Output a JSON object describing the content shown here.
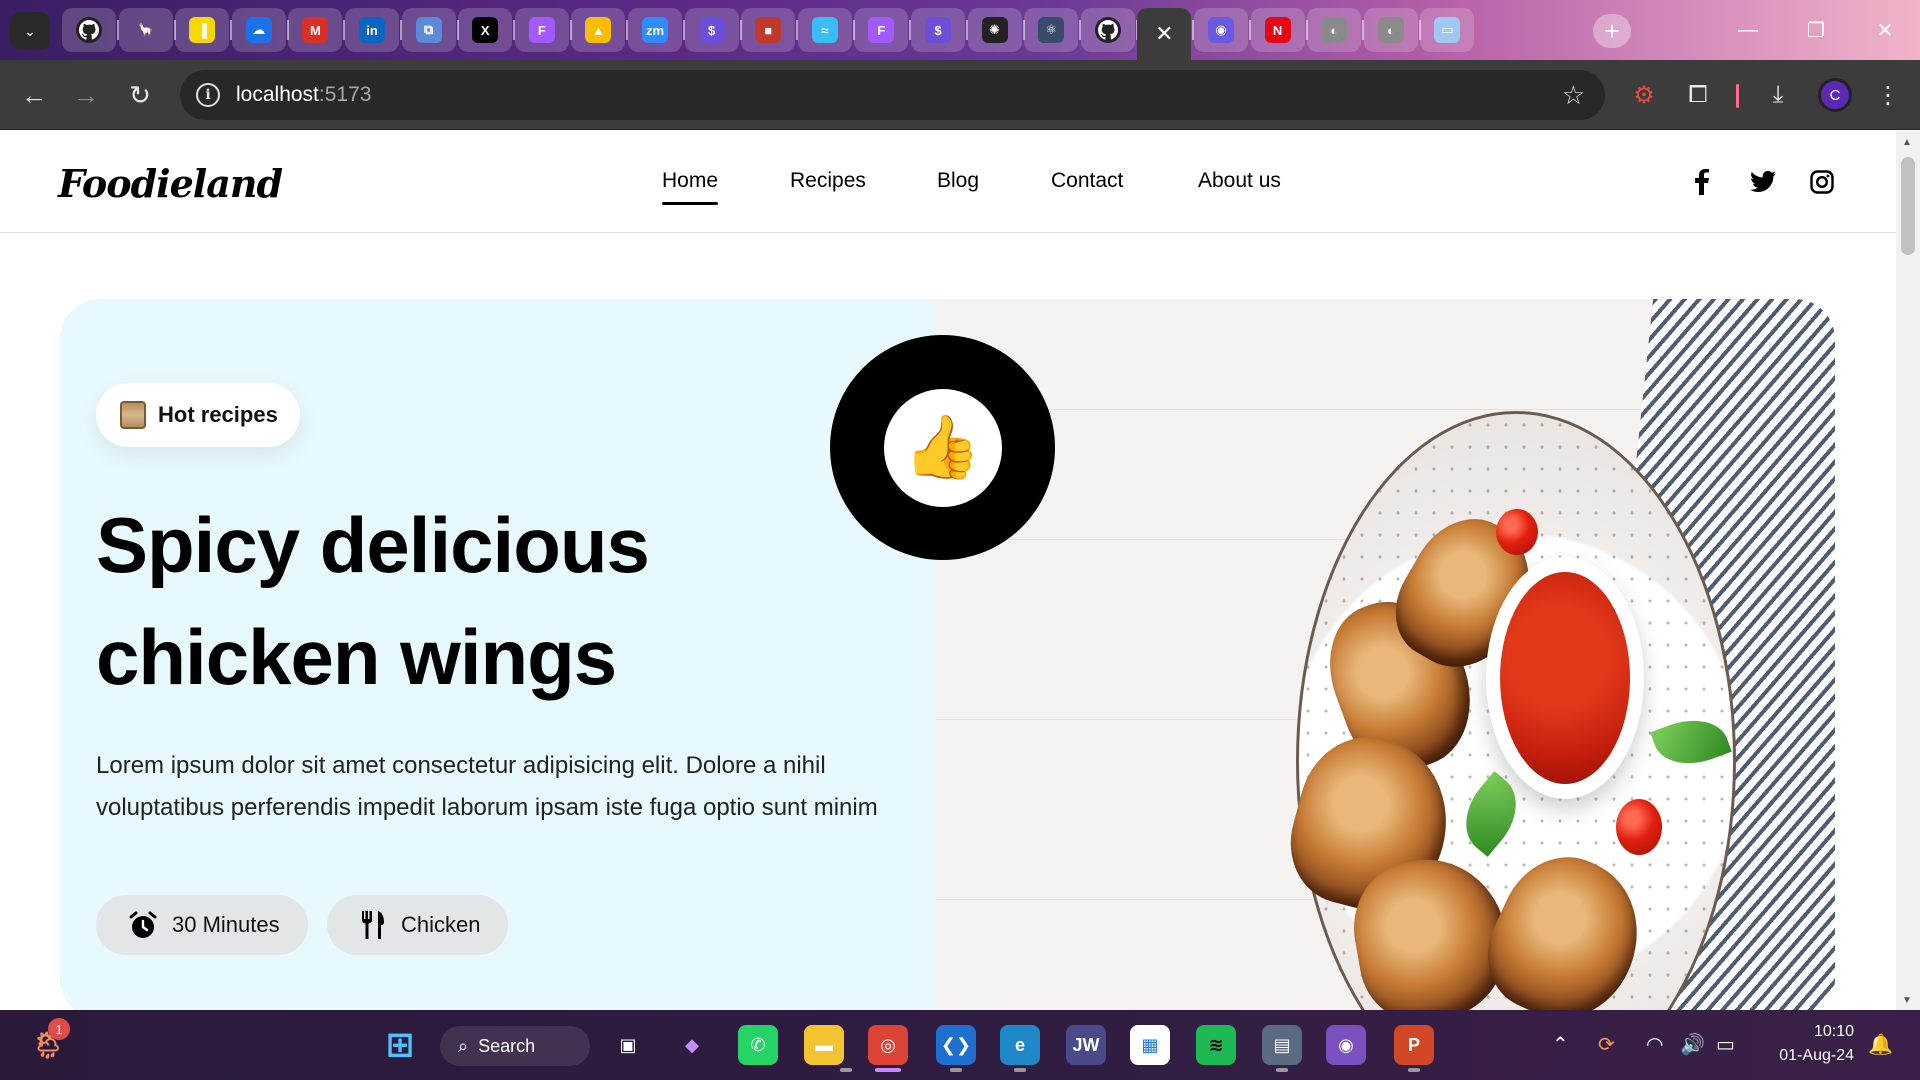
{
  "browser": {
    "url_host": "localhost",
    "url_port": ":5173",
    "profile_initial": "C",
    "tabs": [
      {
        "icon": "github-icon",
        "glyph": "",
        "bg": "#222222"
      },
      {
        "icon": "llama-icon",
        "glyph": "🦙",
        "bg": "transparent"
      },
      {
        "icon": "notes-icon",
        "glyph": "▐",
        "bg": "#f5d800"
      },
      {
        "icon": "cloud-icon",
        "glyph": "☁",
        "bg": "#1a73e8"
      },
      {
        "icon": "gmail-icon",
        "glyph": "M",
        "bg": "#d93025"
      },
      {
        "icon": "linkedin-icon",
        "glyph": "in",
        "bg": "#0a66c2"
      },
      {
        "icon": "crop-icon",
        "glyph": "⧉",
        "bg": "#5a8ad8"
      },
      {
        "icon": "x-icon",
        "glyph": "X",
        "bg": "#000000"
      },
      {
        "icon": "figma-icon",
        "glyph": "F",
        "bg": "#a259ff"
      },
      {
        "icon": "google-ads-icon",
        "glyph": "▲",
        "bg": "#fbbc04"
      },
      {
        "icon": "zoom-icon",
        "glyph": "zm",
        "bg": "#2d8cff"
      },
      {
        "icon": "dollar-icon",
        "glyph": "$",
        "bg": "#6b4fd8"
      },
      {
        "icon": "square-icon",
        "glyph": "■",
        "bg": "#c0392b"
      },
      {
        "icon": "tailwind-icon",
        "glyph": "≈",
        "bg": "#38bdf8"
      },
      {
        "icon": "figma-icon",
        "glyph": "F",
        "bg": "#a259ff"
      },
      {
        "icon": "dollar-icon",
        "glyph": "$",
        "bg": "#6b4fd8"
      },
      {
        "icon": "openai-icon",
        "glyph": "✺",
        "bg": "#222222"
      },
      {
        "icon": "react-icon",
        "glyph": "⚛",
        "bg": "#3a4a6a"
      },
      {
        "icon": "github-icon",
        "glyph": "",
        "bg": "#222222"
      },
      {
        "icon": "close-icon",
        "glyph": "✕",
        "bg": "transparent"
      },
      {
        "icon": "firefox-icon",
        "glyph": "◉",
        "bg": "#6a5ae0"
      },
      {
        "icon": "netflix-icon",
        "glyph": "N",
        "bg": "#e50914"
      },
      {
        "icon": "globe-icon",
        "glyph": "◐",
        "bg": "#8a8a8a"
      },
      {
        "icon": "globe-icon",
        "glyph": "◐",
        "bg": "#8a8a8a"
      },
      {
        "icon": "folder-icon",
        "glyph": "▭",
        "bg": "#9ec8f0"
      }
    ]
  },
  "site": {
    "logo": "Foodieland",
    "nav": [
      {
        "label": "Home",
        "active": true
      },
      {
        "label": "Recipes",
        "active": false
      },
      {
        "label": "Blog",
        "active": false
      },
      {
        "label": "Contact",
        "active": false
      },
      {
        "label": "About us",
        "active": false
      }
    ],
    "social": [
      "facebook-icon",
      "twitter-icon",
      "instagram-icon"
    ]
  },
  "hero": {
    "badge_label": "Hot recipes",
    "title": "Spicy delicious chicken wings",
    "description": "Lorem ipsum dolor sit amet consectetur adipisicing elit. Dolore a nihil voluptatibus perferendis impedit laborum ipsam iste fuga optio sunt minim",
    "time_label": "30 Minutes",
    "category_label": "Chicken",
    "thumb_glyph": "👍"
  },
  "taskbar": {
    "search_label": "Search",
    "time": "10:10",
    "date": "01-Aug-24",
    "notification_count": "1",
    "apps": [
      {
        "icon": "windows-start-icon",
        "glyph": "⊞",
        "bg": "transparent",
        "color": "#4cc2ff"
      },
      {
        "icon": "task-view-icon",
        "glyph": "▣",
        "bg": "transparent",
        "color": "#ffffff"
      },
      {
        "icon": "copilot-icon",
        "glyph": "◆",
        "bg": "transparent",
        "color": "#c58cff"
      },
      {
        "icon": "whatsapp-icon",
        "glyph": "✆",
        "bg": "#25d366",
        "color": "#ffffff"
      },
      {
        "icon": "file-explorer-icon",
        "glyph": "▬",
        "bg": "#f4c430",
        "color": "#ffffff"
      },
      {
        "icon": "chrome-icon",
        "glyph": "◎",
        "bg": "#db4437",
        "color": "#ffffff"
      },
      {
        "icon": "vscode-icon",
        "glyph": "❮❯",
        "bg": "#1f6fd0",
        "color": "#ffffff"
      },
      {
        "icon": "edge-icon",
        "glyph": "e",
        "bg": "#1e88c8",
        "color": "#ffffff"
      },
      {
        "icon": "jw-icon",
        "glyph": "JW",
        "bg": "#4a4a8a",
        "color": "#ffffff"
      },
      {
        "icon": "store-icon",
        "glyph": "▦",
        "bg": "#ffffff",
        "color": "#1e7ed8"
      },
      {
        "icon": "spotify-icon",
        "glyph": "≋",
        "bg": "#1db954",
        "color": "#000000"
      },
      {
        "icon": "calculator-icon",
        "glyph": "▤",
        "bg": "#5a6a80",
        "color": "#ffffff"
      },
      {
        "icon": "github-desktop-icon",
        "glyph": "◉",
        "bg": "#7b4fbe",
        "color": "#ffffff"
      },
      {
        "icon": "powerpoint-icon",
        "glyph": "P",
        "bg": "#d24726",
        "color": "#ffffff"
      }
    ]
  }
}
